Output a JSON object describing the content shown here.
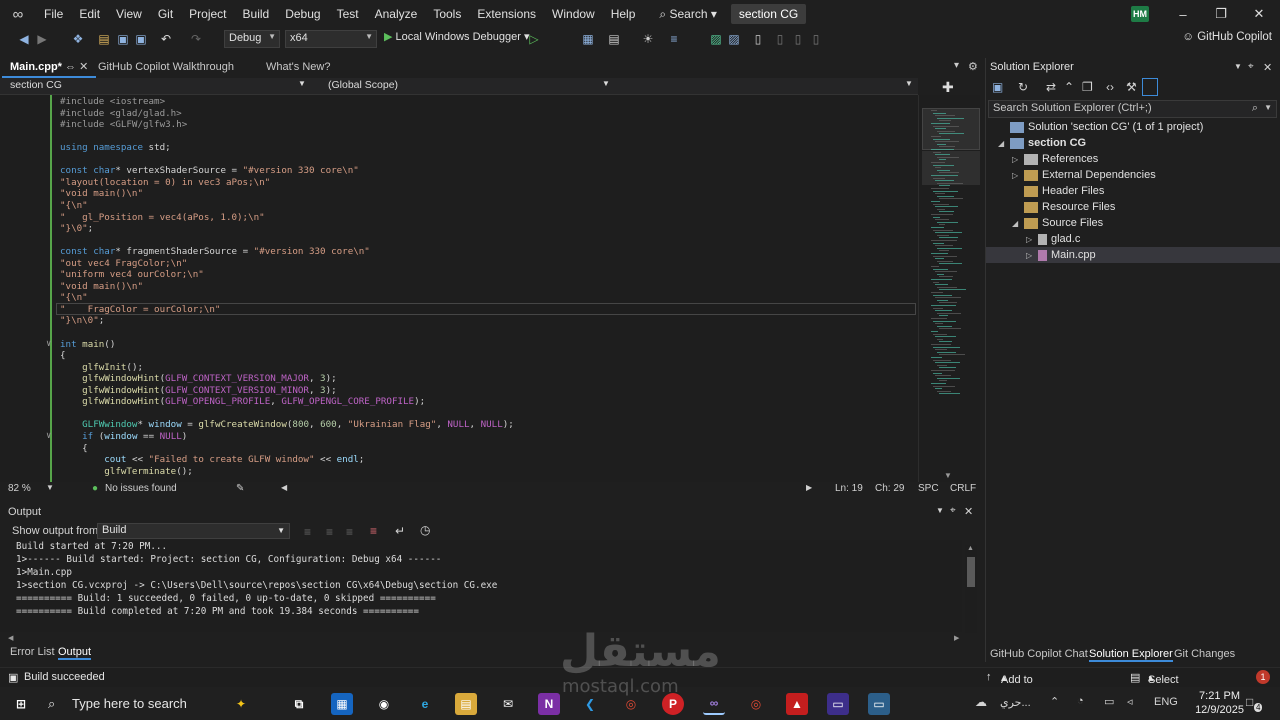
{
  "menu": {
    "items": [
      "File",
      "Edit",
      "View",
      "Git",
      "Project",
      "Build",
      "Debug",
      "Test",
      "Analyze",
      "Tools",
      "Extensions",
      "Window",
      "Help"
    ],
    "search_label": "Search",
    "solution_name": "section CG",
    "user_initials": "HM"
  },
  "toolbar": {
    "config": "Debug",
    "platform": "x64",
    "debugger_label": "Local Windows Debugger",
    "copilot_label": "GitHub Copilot"
  },
  "tabs": [
    {
      "label": "Main.cpp*",
      "active": true
    },
    {
      "label": "GitHub Copilot Walkthrough",
      "active": false
    },
    {
      "label": "What's New?",
      "active": false
    }
  ],
  "navbar": {
    "project": "section CG",
    "scope": "(Global Scope)"
  },
  "code_lines": [
    "#include <iostream>",
    "#include <glad/glad.h>",
    "#include <GLFW/glfw3.h>",
    "",
    "using namespace std;",
    "",
    "const char* vertexShaderSource = \"#version 330 core\\n\"",
    "\"layout(location = 0) in vec3 aPos;\\n\"",
    "\"void main()\\n\"",
    "\"{\\n\"",
    "\"   gl_Position = vec4(aPos, 1.0);\\n\"",
    "\"}\\0\";",
    "",
    "const char* fragmentShaderSource = \"#version 330 core\\n\"",
    "\"out vec4 FragColor;\\n\"",
    "\"uniform vec4 ourColor;\\n\"",
    "\"void main()\\n\"",
    "\"{\\n\"",
    "\"    FragColor = ourColor;\\n\"",
    "\"}\\n\\0\";",
    "",
    "int main()",
    "{",
    "    glfwInit();",
    "    glfwWindowHint(GLFW_CONTEXT_VERSION_MAJOR, 3);",
    "    glfwWindowHint(GLFW_CONTEXT_VERSION_MINOR, 3);",
    "    glfwWindowHint(GLFW_OPENGL_PROFILE, GLFW_OPENGL_CORE_PROFILE);",
    "",
    "    GLFWwindow* window = glfwCreateWindow(800, 600, \"Ukrainian Flag\", NULL, NULL);",
    "    if (window == NULL)",
    "    {",
    "        cout << \"Failed to create GLFW window\" << endl;",
    "        glfwTerminate();"
  ],
  "editor_status": {
    "zoom": "82 %",
    "issues": "No issues found",
    "line": "Ln: 19",
    "col": "Ch: 29",
    "spacing": "SPC",
    "eol": "CRLF"
  },
  "output": {
    "title": "Output",
    "show_from_label": "Show output from:",
    "source": "Build",
    "lines": [
      "Build started at 7:20 PM...",
      "1>------ Build started: Project: section CG, Configuration: Debug x64 ------",
      "1>Main.cpp",
      "1>section CG.vcxproj -> C:\\Users\\Dell\\source\\repos\\section CG\\x64\\Debug\\section CG.exe",
      "========== Build: 1 succeeded, 0 failed, 0 up-to-date, 0 skipped ==========",
      "========== Build completed at 7:20 PM and took 19.384 seconds =========="
    ]
  },
  "bottom_tabs": [
    "Error List",
    "Output"
  ],
  "solution_explorer": {
    "title": "Solution Explorer",
    "search_placeholder": "Search Solution Explorer (Ctrl+;)",
    "tree": [
      {
        "label": "Solution 'section CG' (1 of 1 project)",
        "arrow": "",
        "icon": "solution",
        "bold": false,
        "selected": false
      },
      {
        "label": "section CG",
        "arrow": "◢",
        "icon": "project",
        "bold": true,
        "selected": false
      },
      {
        "label": "References",
        "arrow": "▷",
        "icon": "refs",
        "bold": false,
        "selected": false
      },
      {
        "label": "External Dependencies",
        "arrow": "▷",
        "icon": "folder",
        "bold": false,
        "selected": false
      },
      {
        "label": "Header Files",
        "arrow": "",
        "icon": "folder",
        "bold": false,
        "selected": false
      },
      {
        "label": "Resource Files",
        "arrow": "",
        "icon": "folder",
        "bold": false,
        "selected": false
      },
      {
        "label": "Source Files",
        "arrow": "◢",
        "icon": "folder",
        "bold": false,
        "selected": false
      },
      {
        "label": "glad.c",
        "arrow": "▷",
        "icon": "file",
        "bold": false,
        "selected": false
      },
      {
        "label": "Main.cpp",
        "arrow": "▷",
        "icon": "cpp",
        "bold": false,
        "selected": true
      }
    ],
    "bottom_tabs": [
      "GitHub Copilot Chat",
      "Solution Explorer",
      "Git Changes"
    ]
  },
  "statusbar": {
    "build_status": "Build succeeded",
    "source_control": "Add to Source Control",
    "repo": "Select Repository"
  },
  "taskbar": {
    "search_placeholder": "Type here to search",
    "language": "ENG",
    "time": "7:21 PM",
    "date": "12/9/2025",
    "weather_text": "حري...",
    "notification_count": "4"
  },
  "watermark": {
    "arabic": "مستقل",
    "latin": "mostaql.com"
  },
  "colors": {
    "accent": "#3d8bd9",
    "keyword": "#569cd6",
    "string": "#d69d85",
    "preprocessor": "#9b9b9b",
    "function": "#dcdcaa",
    "type": "#4ec9b0",
    "macro": "#bd63c5",
    "change_bar": "#57a64a"
  }
}
